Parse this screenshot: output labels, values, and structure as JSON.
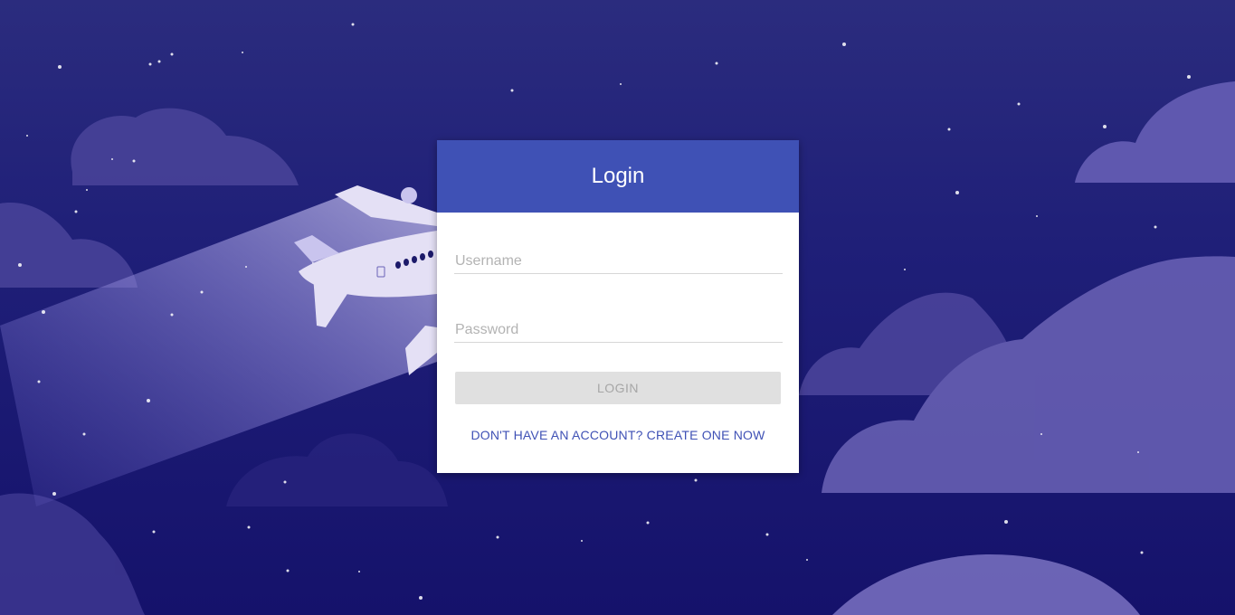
{
  "login": {
    "title": "Login",
    "username_placeholder": "Username",
    "username_value": "",
    "password_placeholder": "Password",
    "password_value": "",
    "submit_label": "LOGIN",
    "signup_link": "DON'T HAVE AN ACCOUNT? CREATE ONE NOW"
  },
  "theme": {
    "accent": "#3f51b5",
    "background": "#1f1f78",
    "button_disabled_bg": "#e0e0e0",
    "button_disabled_text": "#a6a6a6"
  },
  "background_art": {
    "subject": "airplane flying through night sky with clouds and stars"
  }
}
